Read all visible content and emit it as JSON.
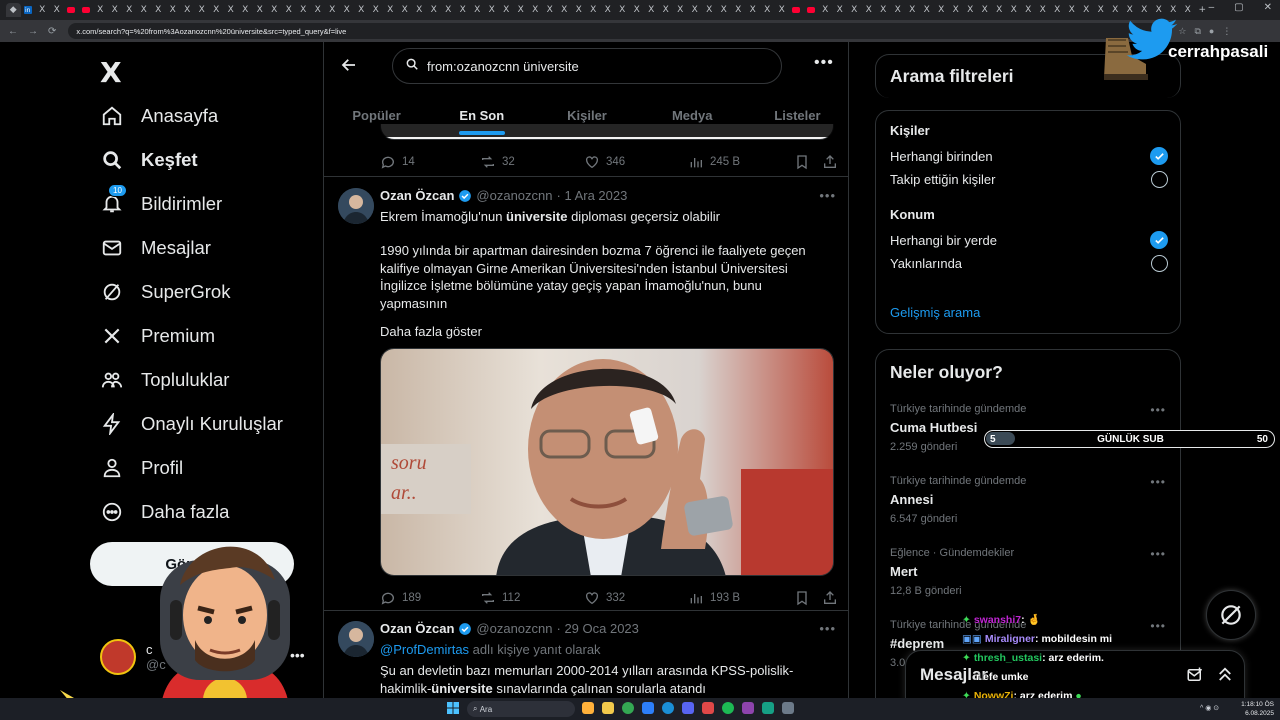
{
  "browser": {
    "tabs": [
      "◆",
      "in",
      "X",
      "X",
      "yt",
      "yt",
      "X",
      "X",
      "X",
      "X",
      "X",
      "X",
      "X",
      "X",
      "X",
      "X",
      "X",
      "X",
      "X",
      "X",
      "X",
      "X",
      "X",
      "X",
      "X",
      "X",
      "X",
      "X",
      "X",
      "X",
      "X",
      "X",
      "X",
      "X",
      "X",
      "X",
      "X",
      "X",
      "X",
      "X",
      "X",
      "X",
      "X",
      "X",
      "X",
      "X",
      "X",
      "X",
      "X",
      "X",
      "X",
      "X",
      "X",
      "X",
      "yt",
      "yt",
      "X",
      "X",
      "X",
      "X",
      "X",
      "X",
      "X",
      "X",
      "X",
      "X",
      "X",
      "X",
      "X",
      "X",
      "X",
      "X",
      "X",
      "X",
      "X",
      "X",
      "X",
      "X",
      "X",
      "X",
      "X",
      "X"
    ],
    "new_tab": "+",
    "window_controls": [
      "–",
      "▢",
      "✕"
    ],
    "url": "x.com/search?q=%20from%3Aozanozcnn%20üniversite&src=typed_query&f=live"
  },
  "sidebar": {
    "logo": "X",
    "items": [
      {
        "label": "Anasayfa",
        "icon": "home-icon"
      },
      {
        "label": "Keşfet",
        "icon": "search-icon",
        "bold": true
      },
      {
        "label": "Bildirimler",
        "icon": "bell-icon",
        "badge": "10"
      },
      {
        "label": "Mesajlar",
        "icon": "mail-icon"
      },
      {
        "label": "SuperGrok",
        "icon": "grok-icon"
      },
      {
        "label": "Premium",
        "icon": "x-icon"
      },
      {
        "label": "Topluluklar",
        "icon": "people-icon"
      },
      {
        "label": "Onaylı Kuruluşlar",
        "icon": "bolt-icon"
      },
      {
        "label": "Profil",
        "icon": "person-icon"
      },
      {
        "label": "Daha fazla",
        "icon": "more-circle-icon"
      }
    ],
    "post_button": "Gönder",
    "account_name": "c",
    "account_handle": "@c"
  },
  "search": {
    "query": "from:ozanozcnn üniversite",
    "tabs": [
      "Popüler",
      "En Son",
      "Kişiler",
      "Medya",
      "Listeler"
    ],
    "active_tab": "En Son"
  },
  "prev_tweet_actions": {
    "replies": "14",
    "reposts": "32",
    "likes": "346",
    "views": "245 B"
  },
  "tweets": [
    {
      "name": "Ozan Özcan",
      "handle": "@ozanozcnn",
      "date": "· 1 Ara 2023",
      "line1_a": "Ekrem İmamoğlu'nun ",
      "line1_b": "üniversite",
      "line1_c": " diploması geçersiz olabilir",
      "paragraph": "1990 yılında bir apartman dairesinden bozma 7 öğrenci ile faaliyete geçen kalifiye olmayan Girne Amerikan Üniversitesi'nden İstanbul Üniversitesi İngilizce İşletme bölümüne yatay geçiş yapan İmamoğlu'nun, bunu yapmasının",
      "show_more": "Daha fazla göster",
      "replies": "189",
      "reposts": "112",
      "likes": "332",
      "views": "193 B"
    },
    {
      "name": "Ozan Özcan",
      "handle": "@ozanozcnn",
      "date": "· 29 Oca 2023",
      "reply_to_handle": "@ProfDemirtas",
      "reply_to_suffix": " adlı kişiye yanıt olarak",
      "line1": "Şu an devletin bazı memurları 2000-2014 yılları arasında KPSS-polislik-",
      "line2_a": "hakimlik-",
      "line2_b": "üniversite",
      "line2_c": " sınavlarında çalınan sorularla atandı"
    }
  ],
  "filters": {
    "title": "Arama filtreleri",
    "people_label": "Kişiler",
    "people_opts": [
      "Herhangi birinden",
      "Takip ettiğin kişiler"
    ],
    "location_label": "Konum",
    "location_opts": [
      "Herhangi bir yerde",
      "Yakınlarında"
    ],
    "advanced": "Gelişmiş arama"
  },
  "trends": {
    "title": "Neler oluyor?",
    "items": [
      {
        "context": "Türkiye tarihinde gündemde",
        "title": "Cuma Hutbesi",
        "count": "2.259 gönderi"
      },
      {
        "context": "Türkiye tarihinde gündemde",
        "title": "Annesi",
        "count": "6.547 gönderi"
      },
      {
        "context": "Eğlence · Gündemdekiler",
        "title": "Mert",
        "count": "12,8 B gönderi"
      },
      {
        "context": "Türkiye tarihinde gündemde",
        "title": "#deprem",
        "count": "3.0"
      }
    ]
  },
  "overlay": {
    "channel": "cerrahpasali",
    "sub_goal": {
      "current": "5",
      "label": "GÜNLÜK SUB",
      "target": "50",
      "progress": 0.1
    },
    "chat": [
      {
        "user": "swanshi7",
        "msg": ": 🤞",
        "color": "#c026d3"
      },
      {
        "user": "Miraligner",
        "msg": ": mobildesin mi",
        "color": "#a78bfa"
      },
      {
        "user": "thresh_ustasi",
        "msg": ": arz ederim.",
        "color": "#22c55e"
      },
      {
        "user": "",
        "msg": "r efe umke",
        "color": "#ffffff"
      },
      {
        "user": "NowwZi",
        "msg": ": arz ederim",
        "color": "#eab308"
      }
    ]
  },
  "messages_drawer": {
    "title": "Mesajlar"
  },
  "taskbar": {
    "search": "Ara",
    "time": "1:18:10 ÖS",
    "date": "6.08.2025"
  }
}
